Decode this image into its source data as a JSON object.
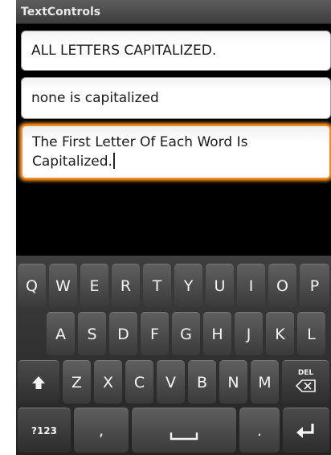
{
  "app": {
    "title": "TextControls"
  },
  "fields": [
    {
      "value": "ALL LETTERS CAPITALIZED."
    },
    {
      "value": "none is capitalized"
    },
    {
      "value": "The First Letter Of Each Word Is Capitalized."
    }
  ],
  "keyboard": {
    "row1": [
      "Q",
      "W",
      "E",
      "R",
      "T",
      "Y",
      "U",
      "I",
      "O",
      "P"
    ],
    "row2": [
      "A",
      "S",
      "D",
      "F",
      "G",
      "H",
      "J",
      "K",
      "L"
    ],
    "row3": [
      "Z",
      "X",
      "C",
      "V",
      "B",
      "N",
      "M"
    ],
    "symbols_label": "?123",
    "comma": ",",
    "period": ".",
    "del_label": "DEL",
    "icons": [
      "shift-icon",
      "delete-icon",
      "space-icon",
      "enter-icon"
    ]
  },
  "colors": {
    "focus_border": "#ff8a1c",
    "keyboard_bg": "#2e2e2e",
    "key_bg": "#4a4a4a",
    "title_bg": "#4a4a4a"
  }
}
